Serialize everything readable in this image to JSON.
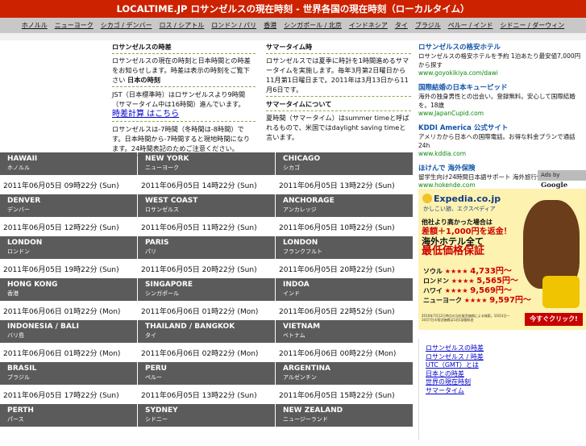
{
  "header": {
    "title": "LOCALTIME.JP ロサンゼルスの現在時刻 - 世界各国の現在時刻（ローカルタイム）"
  },
  "nav": [
    "ホノルル",
    "ニューヨーク",
    "シカゴ / デンバー",
    "ロス / シアトル",
    "ロンドン / パリ",
    "香港",
    "シンガポール / 北京",
    "インドネシア",
    "タイ",
    "ブラジル",
    "ペルー / インド",
    "シドニー / ダーウィン"
  ],
  "intro": {
    "col1": {
      "heading": "ロサンゼルスの時差",
      "p1": "ロサンゼルスの現在の時刻と日本時間との時差をお知らせします。時差は表示の時刻をご覧下さい",
      "p1_bold": "日本の時刻",
      "p2": "JST（日本標準時）はロサンゼルスより9時間（サマータイム中は16時間）進んでいます。",
      "p2_link": "時差計算 はこちら",
      "p3": "ロサンゼルスは-7時間（冬時間は-8時間）です。日本時間から-7時間すると現地時間になります。24時間表記のためご注意ください。"
    },
    "col2": {
      "heading": "サマータイム時",
      "p1": "ロサンゼルスでは夏季に時計を1時間進めるサマータイムを実施します。毎年3月第2日曜日から11月第1日曜日まで。2011年は3月13日から11月6日です。",
      "subheading": "サマータイムについて",
      "p2": "夏時間（サマータイム）はsummer timeと呼ばれるもので、米国ではdaylight saving timeと言います。"
    }
  },
  "cities": [
    {
      "en": "HAWAII",
      "jp": "ホノルル",
      "time": "2011年06月05日 09時22分 (Sun)"
    },
    {
      "en": "NEW YORK",
      "jp": "ニューヨーク",
      "time": "2011年06月05日 14時22分 (Sun)"
    },
    {
      "en": "CHICAGO",
      "jp": "シカゴ",
      "time": "2011年06月05日 13時22分 (Sun)"
    },
    {
      "en": "DENVER",
      "jp": "デンバー",
      "time": "2011年06月05日 12時22分 (Sun)"
    },
    {
      "en": "WEST COAST",
      "jp": "ロサンゼルス",
      "time": "2011年06月05日 11時22分 (Sun)"
    },
    {
      "en": "ANCHORAGE",
      "jp": "アンカレッジ",
      "time": "2011年06月05日 10時22分 (Sun)"
    },
    {
      "en": "LONDON",
      "jp": "ロンドン",
      "time": "2011年06月05日 19時22分 (Sun)"
    },
    {
      "en": "PARIS",
      "jp": "パリ",
      "time": "2011年06月05日 20時22分 (Sun)"
    },
    {
      "en": "LONDON",
      "jp": "フランクフルト",
      "time": "2011年06月05日 20時22分 (Sun)"
    },
    {
      "en": "HONG KONG",
      "jp": "香港",
      "time": "2011年06月06日 01時22分 (Mon)"
    },
    {
      "en": "SINGAPORE",
      "jp": "シンガポール",
      "time": "2011年06月06日 01時22分 (Mon)"
    },
    {
      "en": "INDOA",
      "jp": "インド",
      "time": "2011年06月05日 22時52分 (Sun)"
    },
    {
      "en": "INDONESIA / BALI",
      "jp": "バリ島",
      "time": "2011年06月06日 01時22分 (Mon)"
    },
    {
      "en": "THAILAND / BANGKOK",
      "jp": "タイ",
      "time": "2011年06月06日 02時22分 (Mon)"
    },
    {
      "en": "VIETNAM",
      "jp": "ベトナム",
      "time": "2011年06月06日 00時22分 (Mon)"
    },
    {
      "en": "BRASIL",
      "jp": "ブラジル",
      "time": "2011年06月05日 17時22分 (Sun)"
    },
    {
      "en": "PERU",
      "jp": "ペルー",
      "time": "2011年06月05日 13時22分 (Sun)"
    },
    {
      "en": "ARGENTINA",
      "jp": "アルゼンチン",
      "time": "2011年06月05日 15時22分 (Sun)"
    },
    {
      "en": "PERTH",
      "jp": "パース",
      "time": ""
    },
    {
      "en": "SYDNEY",
      "jp": "シドニー",
      "time": ""
    },
    {
      "en": "NEW ZEALAND",
      "jp": "ニュージーランド",
      "time": ""
    }
  ],
  "ads": [
    {
      "title": "ロサンゼルスの格安ホテル",
      "desc": "ロサンゼルスの格安ホテルを予約 1泊あたり最安値7,000円から探す",
      "url": "www.goyokikiya.com/dawi"
    },
    {
      "title": "国際結婚の日本キューピッド",
      "desc": "海外の独身男性との出会い。登録無料。安心して国際結婚を。18歳",
      "url": "www.JapanCupid.com"
    },
    {
      "title": "KDDI America 公式サイト",
      "desc": "アメリカから日本への国際電話。お得な料金プランで通話24h",
      "url": "www.kddia.com"
    },
    {
      "title": "ほけんで 海外保険",
      "desc": "留学生向け24時間日本語サポート 海外旅行保険の比較と加入",
      "url": "www.hokende.com"
    }
  ],
  "adsby": {
    "label": "Ads by",
    "brand": "Google"
  },
  "banner": {
    "logo": "Expedia.co.jp",
    "sub": "かしこい旅、エクスペディア",
    "line1": "他社より高かった場合は",
    "line2": "差額＋1,000円を返金！",
    "line3": "海外ホテル全て",
    "line4": "最低価格保証",
    "prices": [
      {
        "city": "ソウル",
        "stars": "★★★★",
        "price": "4,733円〜"
      },
      {
        "city": "ロンドン",
        "stars": "★★★★",
        "price": "5,565円〜"
      },
      {
        "city": "ハワイ",
        "stars": "★★★★",
        "price": "9,569円〜"
      },
      {
        "city": "ニューヨーク",
        "stars": "★★★★",
        "price": "9,597円〜"
      }
    ],
    "note": "2010年7月12日時点の当社販売価格による検索。10月4日〜10月7日の宿泊価格は1泊1部屋料金",
    "button": "今すぐクリック!"
  },
  "links": [
    "ロサンゼルスの時差",
    "ロサンゼルス / 時差",
    "UTC（GMT）とは",
    "日本との時差",
    "世界の現在時刻",
    "サマータイム"
  ]
}
